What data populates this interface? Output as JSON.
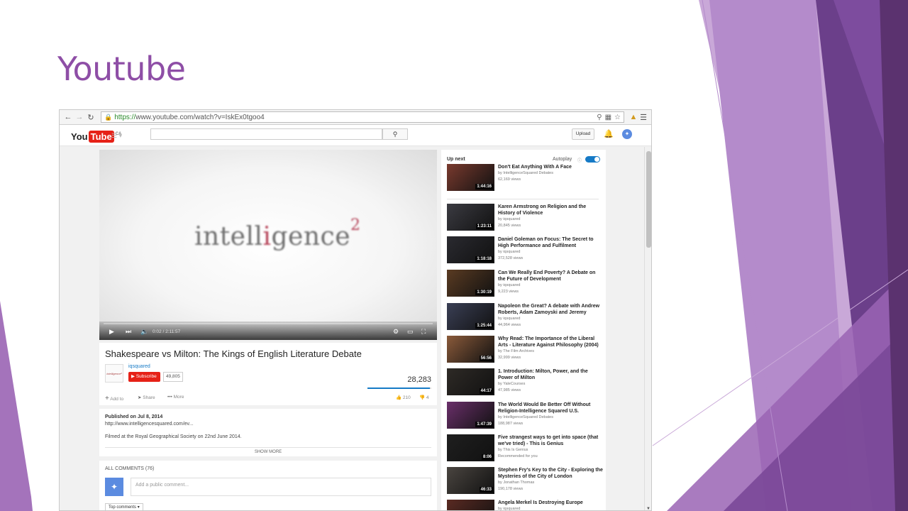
{
  "slide": {
    "title": "Youtube",
    "accent_color": "#8e4ea6"
  },
  "browser": {
    "url_https": "https://",
    "url_rest": "www.youtube.com/watch?v=IskEx0tgoo4",
    "back_icon": "back-arrow-icon",
    "forward_icon": "forward-arrow-icon",
    "reload_icon": "reload-icon"
  },
  "youtube": {
    "logo_you": "You",
    "logo_tube": "Tube",
    "logo_region": "CA",
    "search_placeholder": "",
    "upload_label": "Upload"
  },
  "player": {
    "logo_text_a": "intell",
    "logo_text_g": "i",
    "logo_text_b": "gence",
    "logo_sup": "2",
    "time": "0:02 / 2:11:57"
  },
  "video": {
    "title": "Shakespeare vs Milton: The Kings of English Literature Debate",
    "channel": "iqsquared",
    "channel_logo_text": "intelligence²",
    "subscribe_label": "Subscribe",
    "subscriber_count": "49,805",
    "view_count": "28,283",
    "like_ratio": 0.98,
    "add_to_label": "Add to",
    "share_label": "Share",
    "more_label": "More",
    "likes": "210",
    "dislikes": "4"
  },
  "description": {
    "published": "Published on Jul 8, 2014",
    "link": "http://www.intelligencesquared.com/ev...",
    "text": "Filmed at the Royal Geographical Society on 22nd June 2014.",
    "show_more": "SHOW MORE"
  },
  "comments": {
    "title": "ALL COMMENTS (76)",
    "placeholder": "Add a public comment...",
    "sort_label": "Top comments"
  },
  "sidebar": {
    "up_next_label": "Up next",
    "autoplay_label": "Autoplay",
    "autoplay_on": true,
    "videos": [
      {
        "title": "Don't Eat Anything With A Face",
        "channel": "by IntelligenceSquared Debates",
        "views": "62,169 views",
        "duration": "1:44:16",
        "color": "#7a3a2e"
      },
      {
        "title": "Karen Armstrong on Religion and the History of Violence",
        "channel": "by iqsquared",
        "views": "20,845 views",
        "duration": "1:23:11",
        "color": "#3b3b42"
      },
      {
        "title": "Daniel Goleman on Focus: The Secret to High Performance and Fulfilment",
        "channel": "by iqsquared",
        "views": "372,528 views",
        "duration": "1:18:18",
        "color": "#2a2a30"
      },
      {
        "title": "Can We Really End Poverty? A Debate on the Future of Development",
        "channel": "by iqsquared",
        "views": "9,223 views",
        "duration": "1:30:19",
        "color": "#5a3b22"
      },
      {
        "title": "Napoleon the Great? A debate with Andrew Roberts, Adam Zamoyski and Jeremy",
        "channel": "by iqsquared",
        "views": "44,964 views",
        "duration": "1:25:44",
        "color": "#3a3f55"
      },
      {
        "title": "Why Read: The Importance of the Liberal Arts - Literature Against Philosophy (2004)",
        "channel": "by The Film Archives",
        "views": "32,999 views",
        "duration": "56:56",
        "color": "#8a5a3a"
      },
      {
        "title": "1. Introduction: Milton, Power, and the Power of Milton",
        "channel": "by YaleCourses",
        "views": "47,985 views",
        "duration": "44:17",
        "color": "#2e2a26"
      },
      {
        "title": "The World Would Be Better Off Without Religion-Intelligence Squared U.S.",
        "channel": "by IntelligenceSquared Debates",
        "views": "188,987 views",
        "duration": "1:47:39",
        "color": "#6a2f6a"
      },
      {
        "title": "Five strangest ways to get into space (that we've tried) - This is Genius",
        "channel": "by This Is Genius",
        "views": "Recommended for you",
        "duration": "8:06",
        "color": "#1f1f1f"
      },
      {
        "title": "Stephen Fry's Key to the City - Exploring the Mysteries of the City of London",
        "channel": "by Jonathan Thomas",
        "views": "190,178 views",
        "duration": "46:33",
        "color": "#4a4540"
      },
      {
        "title": "Angela Merkel Is Destroying Europe",
        "channel": "by iqsquared",
        "views": "",
        "duration": "",
        "color": "#5a2a22"
      }
    ]
  }
}
